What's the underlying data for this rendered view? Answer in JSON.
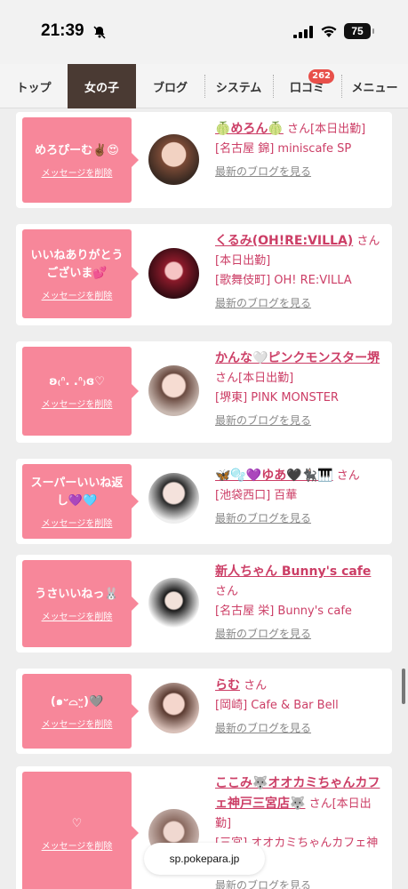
{
  "status": {
    "time": "21:39",
    "battery": "75"
  },
  "tabs": [
    {
      "label": "トップ",
      "active": false
    },
    {
      "label": "女の子",
      "active": true
    },
    {
      "label": "ブログ",
      "active": false
    },
    {
      "label": "システム",
      "active": false
    },
    {
      "label": "口コミ",
      "active": false,
      "badge": "262"
    },
    {
      "label": "メニュー",
      "active": false
    }
  ],
  "delete_label": "メッセージを削除",
  "san_label": "さん",
  "blog_label": "最新のブログを見る",
  "cards": [
    {
      "message": "めろぴーむ✌🏾😍",
      "name": "🍈めろん🍈",
      "status": "[本日出勤]",
      "shop": "[名古屋 錦] miniscafe SP"
    },
    {
      "message": "いいねありがとうございま💕",
      "name": "くるみ(OH!RE:VILLA)",
      "status": "[本日出勤]",
      "shop": "[歌舞伎町] OH! RE:VILLA"
    },
    {
      "message": "ʚ₍ᐢ. .ᐢ₎ɞ♡",
      "name": "かんな🤍ピンクモンスター堺",
      "status": "[本日出勤]",
      "shop": "[堺東] PINK MONSTER"
    },
    {
      "message": "スーパーいいね返し💜🩵",
      "name": "🦋🫧💜ゆあ🖤🐈‍⬛🎹",
      "status": "",
      "shop": "[池袋西口] 百華"
    },
    {
      "message": "うさいいねっ🐰",
      "name": "新人ちゃん Bunny's cafe",
      "status": "",
      "shop": "[名古屋 栄] Bunny's cafe"
    },
    {
      "message": "(๑ᵕ⌓ᵕ̤)🩶",
      "name": "らむ",
      "status": "",
      "shop": "[岡崎] Cafe & Bar Bell"
    },
    {
      "message": "♡",
      "name": "ここみ🐺オオカミちゃんカフェ神戸三宮店🐺",
      "status": "[本日出勤]",
      "shop": "[三宮] オオカミちゃんカフェ神戸三宮店"
    }
  ],
  "url": "sp.pokepara.jp"
}
